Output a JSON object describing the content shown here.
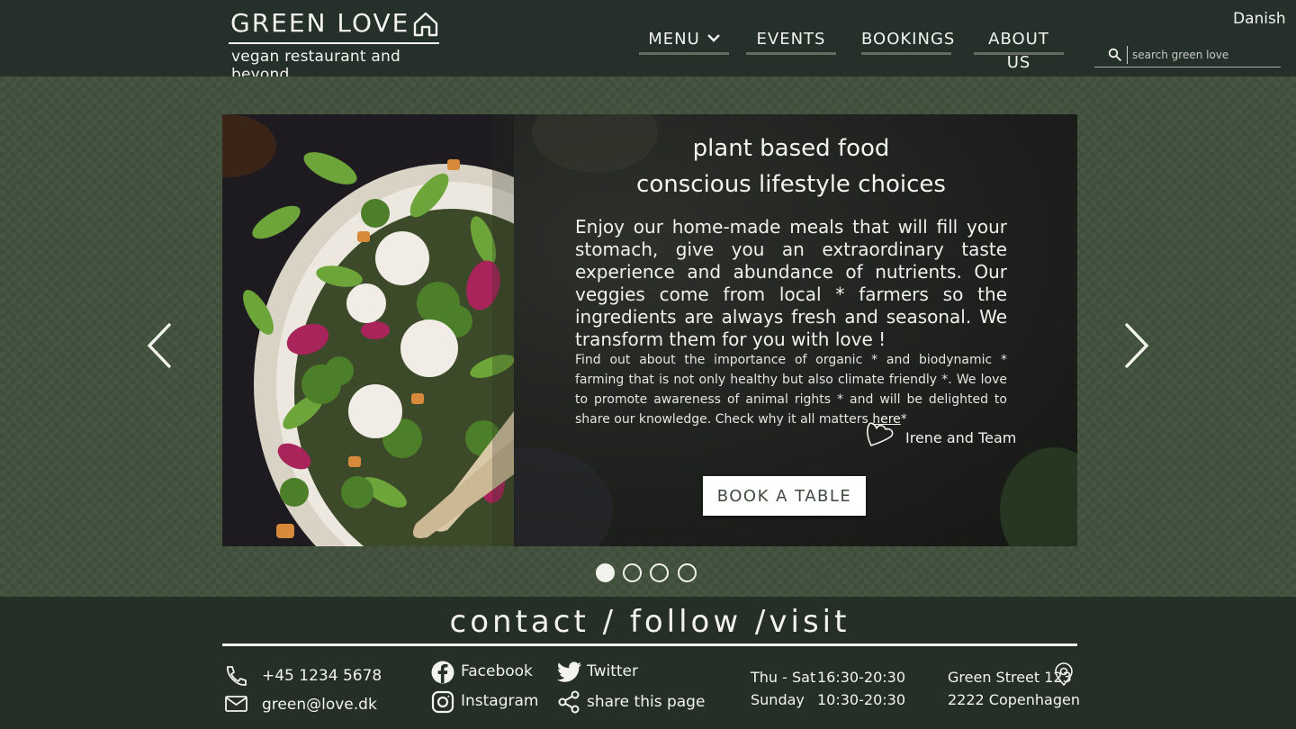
{
  "brand": {
    "title": "GREEN LOVE",
    "tagline": "vegan restaurant and beyond"
  },
  "nav": {
    "items": [
      {
        "label": "MENU",
        "dropdown": true
      },
      {
        "label": "EVENTS"
      },
      {
        "label": "BOOKINGS"
      },
      {
        "label": "ABOUT US"
      }
    ]
  },
  "language": "Danish",
  "search": {
    "placeholder": "search green love",
    "value": ""
  },
  "hero": {
    "headline_line1": "plant based food",
    "headline_line2": "conscious lifestyle choices",
    "lead": "Enjoy our home-made meals that will fill your stomach, give you an extraordinary taste experience and abundance of nutrients.  Our veggies come from local * farmers so the ingredients are always fresh and seasonal. We transform them for you with love !",
    "detail_text": "Find out about the importance of organic * and  biodynamic * farming that is not only healthy but also climate friendly *. We love to promote awareness of animal rights * and will be delighted to share our knowledge. Check why it all matters ",
    "detail_link": "here",
    "detail_suffix": "*",
    "signoff": "Irene and Team",
    "cta": "BOOK A TABLE",
    "slides_total": 4,
    "active_slide": 1
  },
  "footer": {
    "title": "contact / follow /visit",
    "phone": "+45 1234 5678",
    "email": "green@love.dk",
    "facebook": "Facebook",
    "instagram": "Instagram",
    "twitter": "Twitter",
    "share": "share this page",
    "hours": [
      {
        "day": "Thu - Sat",
        "time": "16:30-20:30"
      },
      {
        "day": "Sunday",
        "time": "10:30-20:30"
      }
    ],
    "address_line1": "Green Street 123",
    "address_line2": "2222 Copenhagen"
  },
  "icons": [
    "home-icon",
    "chevron-down-icon",
    "search-icon",
    "chevron-left-icon",
    "chevron-right-icon",
    "heart-icon",
    "phone-icon",
    "mail-icon",
    "facebook-icon",
    "instagram-icon",
    "twitter-icon",
    "share-icon",
    "map-pin-icon"
  ],
  "colors": {
    "header_bg": "#26302a",
    "hero_bg": "#3f4f3a",
    "footer_bg": "#252e27",
    "text": "#f3f3ee",
    "button_text": "#3f4a3e"
  }
}
